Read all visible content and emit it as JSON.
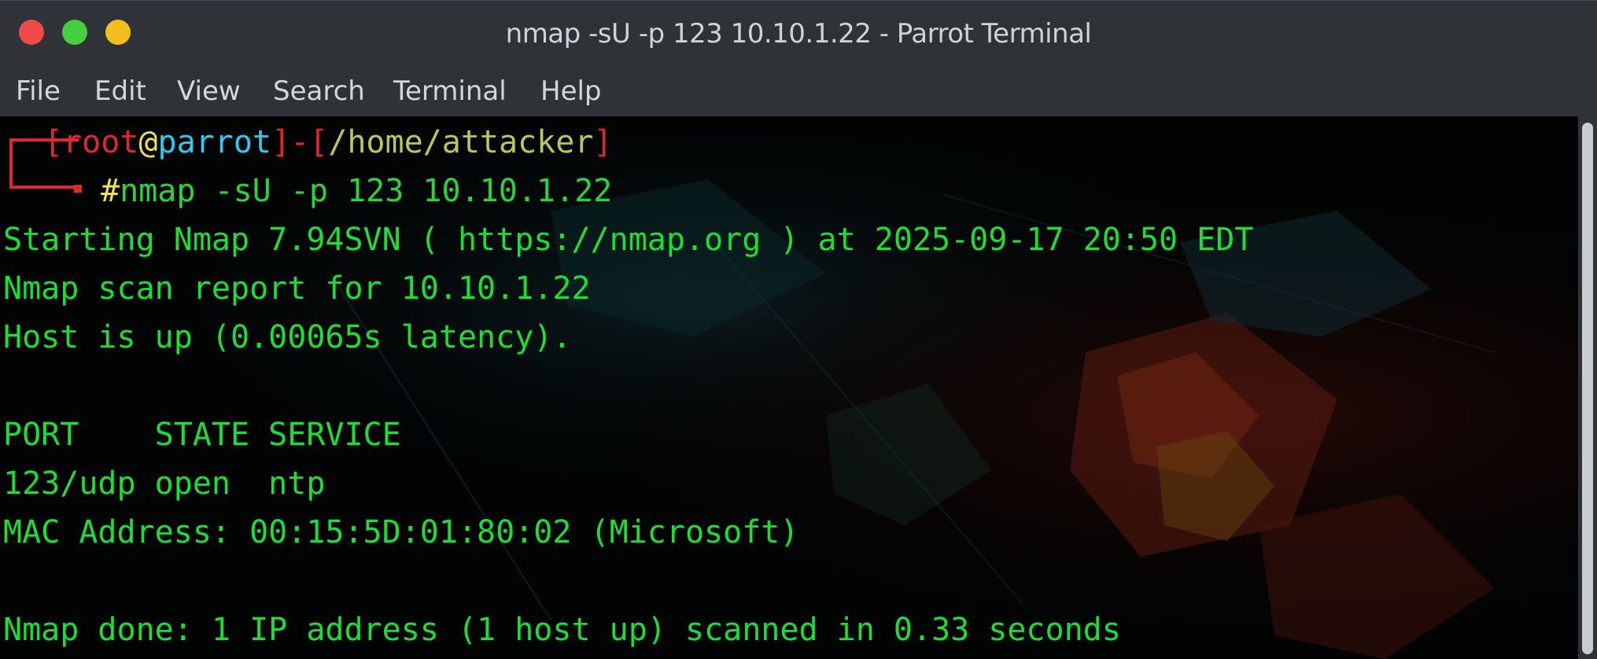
{
  "window": {
    "title": "nmap -sU -p 123 10.10.1.22 - Parrot Terminal"
  },
  "menu": [
    "File",
    "Edit",
    "View",
    "Search",
    "Terminal",
    "Help"
  ],
  "prompt": {
    "user": "root",
    "at": "@",
    "host": "parrot",
    "path": "/home/attacker",
    "hash": "#",
    "command": "nmap -sU -p 123 10.10.1.22"
  },
  "output": [
    "Starting Nmap 7.94SVN ( https://nmap.org ) at 2025-09-17 20:50 EDT",
    "Nmap scan report for 10.10.1.22",
    "Host is up (0.00065s latency).",
    "",
    "PORT    STATE SERVICE",
    "123/udp open  ntp",
    "MAC Address: 00:15:5D:01:80:02 (Microsoft)",
    "",
    "Nmap done: 1 IP address (1 host up) scanned in 0.33 seconds"
  ],
  "colors": {
    "output_green": "#19e032",
    "prompt_red": "#e0282d",
    "host_cyan": "#32c8f0",
    "hash_yellow": "#f2e24a"
  }
}
